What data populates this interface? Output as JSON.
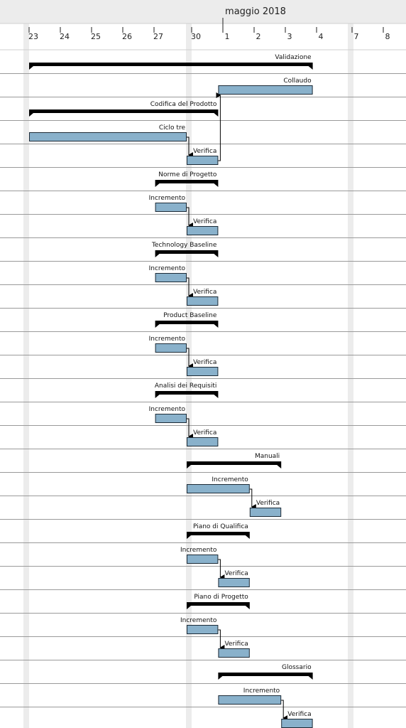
{
  "chart_data": {
    "type": "gantt",
    "month_label": "maggio 2018",
    "day_ticks": [
      "23",
      "24",
      "25",
      "26",
      "27",
      "30",
      "1",
      "2",
      "3",
      "4",
      "7",
      "8"
    ],
    "colors": {
      "task_fill": "#89b1cb",
      "task_stroke": "#1c2a36",
      "group_fill": "#000000",
      "weekend_band": "#ececec",
      "header_bg": "#ececec",
      "row_line": "#9a9a9a"
    },
    "rows": [
      {
        "label": "Validazione",
        "kind": "group",
        "start": 0,
        "end": 9
      },
      {
        "label": "Collaudo",
        "kind": "task",
        "start": 6,
        "end": 9
      },
      {
        "label": "Codifica del Prodotto",
        "kind": "group",
        "start": 0,
        "end": 6
      },
      {
        "label": "Ciclo tre",
        "kind": "task",
        "start": 0,
        "end": 5
      },
      {
        "label": "Verifica",
        "kind": "task",
        "start": 5,
        "end": 6
      },
      {
        "label": "Norme di Progetto",
        "kind": "group",
        "start": 4,
        "end": 6
      },
      {
        "label": "Incremento",
        "kind": "task",
        "start": 4,
        "end": 5
      },
      {
        "label": "Verifica",
        "kind": "task",
        "start": 5,
        "end": 6
      },
      {
        "label": "Technology Baseline",
        "kind": "group",
        "start": 4,
        "end": 6
      },
      {
        "label": "Incremento",
        "kind": "task",
        "start": 4,
        "end": 5
      },
      {
        "label": "Verifica",
        "kind": "task",
        "start": 5,
        "end": 6
      },
      {
        "label": "Product Baseline",
        "kind": "group",
        "start": 4,
        "end": 6
      },
      {
        "label": "Incremento",
        "kind": "task",
        "start": 4,
        "end": 5
      },
      {
        "label": "Verifica",
        "kind": "task",
        "start": 5,
        "end": 6
      },
      {
        "label": "Analisi dei Requisiti",
        "kind": "group",
        "start": 4,
        "end": 6
      },
      {
        "label": "Incremento",
        "kind": "task",
        "start": 4,
        "end": 5
      },
      {
        "label": "Verifica",
        "kind": "task",
        "start": 5,
        "end": 6
      },
      {
        "label": "Manuali",
        "kind": "group",
        "start": 5,
        "end": 8
      },
      {
        "label": "Incremento",
        "kind": "task",
        "start": 5,
        "end": 7
      },
      {
        "label": "Verifica",
        "kind": "task",
        "start": 7,
        "end": 8
      },
      {
        "label": "Piano di Qualifica",
        "kind": "group",
        "start": 5,
        "end": 7
      },
      {
        "label": "Incremento",
        "kind": "task",
        "start": 5,
        "end": 6
      },
      {
        "label": "Verifica",
        "kind": "task",
        "start": 6,
        "end": 7
      },
      {
        "label": "Piano di Progetto",
        "kind": "group",
        "start": 5,
        "end": 7
      },
      {
        "label": "Incremento",
        "kind": "task",
        "start": 5,
        "end": 6
      },
      {
        "label": "Verifica",
        "kind": "task",
        "start": 6,
        "end": 7
      },
      {
        "label": "Glossario",
        "kind": "group",
        "start": 6,
        "end": 9
      },
      {
        "label": "Incremento",
        "kind": "task",
        "start": 6,
        "end": 8
      },
      {
        "label": "Verifica",
        "kind": "task",
        "start": 8,
        "end": 9
      }
    ],
    "dependencies": [
      [
        3,
        4
      ],
      [
        4,
        1
      ],
      [
        6,
        7
      ],
      [
        9,
        10
      ],
      [
        12,
        13
      ],
      [
        15,
        16
      ],
      [
        18,
        19
      ],
      [
        21,
        22
      ],
      [
        24,
        25
      ],
      [
        27,
        28
      ]
    ]
  }
}
